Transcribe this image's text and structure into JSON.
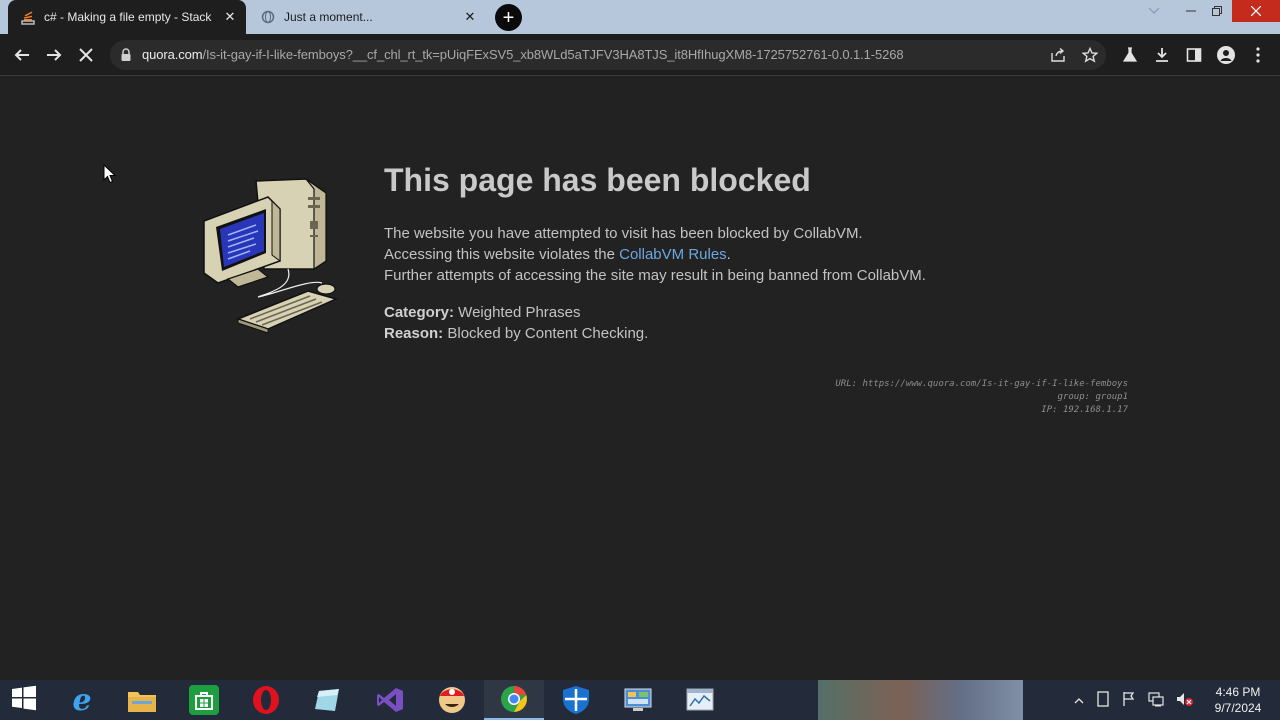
{
  "browser": {
    "tabs": [
      {
        "title": "c# - Making a file empty - Stack",
        "favicon": "stackoverflow-icon",
        "active": true
      },
      {
        "title": "Just a moment...",
        "favicon": "loading-globe-icon",
        "active": false
      }
    ],
    "new_tab_label": "+",
    "address": {
      "host": "quora.com",
      "path": "/Is-it-gay-if-I-like-femboys?__cf_chl_rt_tk=pUiqFExSV5_xb8WLd5aTJFV3HA8TJS_it8HfIhugXM8-1725752761-0.0.1.1-5268"
    }
  },
  "page": {
    "heading": "This page has been blocked",
    "line1": "The website you have attempted to visit has been blocked by CollabVM.",
    "line2_before": "Accessing this website violates the ",
    "line2_link": "CollabVM Rules",
    "line2_after": ".",
    "line3": "Further attempts of accessing the site may result in being banned from CollabVM.",
    "category_label": "Category:",
    "category_value": " Weighted Phrases",
    "reason_label": "Reason:",
    "reason_value": " Blocked by Content Checking.",
    "details": {
      "url_label": "URL: ",
      "url_value": "https://www.quora.com/Is-it-gay-if-I-like-femboys",
      "group_line": "group: group1",
      "ip_line": "IP: 192.168.1.17"
    }
  },
  "taskbar": {
    "items": [
      {
        "name": "start-button",
        "icon": "windows-logo-icon"
      },
      {
        "name": "internet-explorer",
        "icon": "ie-icon"
      },
      {
        "name": "file-explorer",
        "icon": "folder-icon"
      },
      {
        "name": "windows-store",
        "icon": "store-icon"
      },
      {
        "name": "opera-browser",
        "icon": "opera-icon"
      },
      {
        "name": "app-launcher",
        "icon": "blue-box-icon"
      },
      {
        "name": "visual-studio",
        "icon": "visual-studio-icon"
      },
      {
        "name": "mario-game",
        "icon": "mario-icon"
      },
      {
        "name": "chrome-browser",
        "icon": "chrome-icon"
      },
      {
        "name": "windows-defender",
        "icon": "shield-icon"
      },
      {
        "name": "control-panel",
        "icon": "control-panel-icon"
      },
      {
        "name": "task-manager",
        "icon": "chart-window-icon"
      }
    ],
    "time": "4:46 PM",
    "date": "9/7/2024"
  },
  "colors": {
    "page_bg": "#222222",
    "link": "#6ea7e0",
    "tab_strip": "#b6c7dc",
    "close_red": "#c42b1c"
  }
}
